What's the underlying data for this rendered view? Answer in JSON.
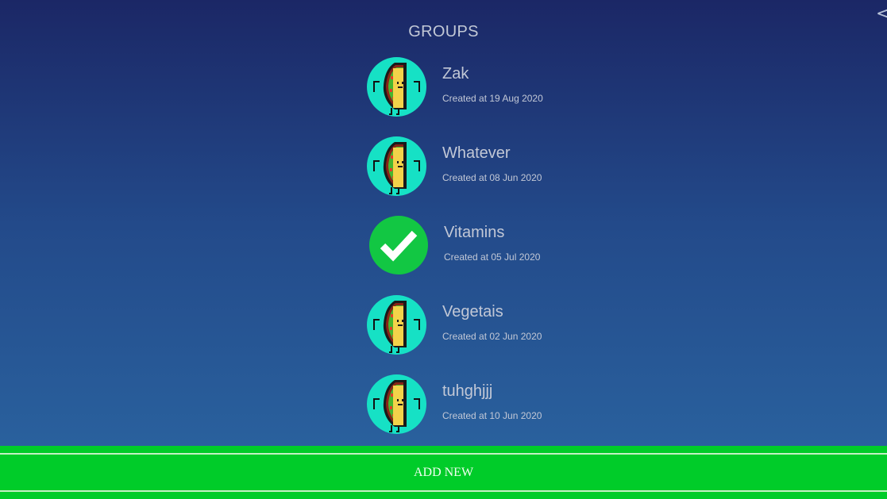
{
  "header": {
    "title": "GROUPS",
    "back_icon": "chevron-left-icon"
  },
  "groups": [
    {
      "name": "Zak",
      "created": "Created at 19 Aug 2020",
      "avatar": "taco-icon",
      "selected": false
    },
    {
      "name": "Whatever",
      "created": "Created at 08 Jun 2020",
      "avatar": "taco-icon",
      "selected": false
    },
    {
      "name": "Vitamins",
      "created": "Created at 05 Jul 2020",
      "avatar": "checkmark-icon",
      "selected": true
    },
    {
      "name": "Vegetais",
      "created": "Created at 02 Jun 2020",
      "avatar": "taco-icon",
      "selected": false
    },
    {
      "name": "tuhghjjj",
      "created": "Created at 10 Jun 2020",
      "avatar": "taco-icon",
      "selected": false
    }
  ],
  "footer": {
    "add_label": "ADD NEW"
  },
  "colors": {
    "background_top": "#1b2766",
    "background_bottom": "#2b66a2",
    "avatar_teal": "#16e1c5",
    "selected_green": "#12c743",
    "add_bar_green": "#00cc29",
    "text_light": "#c2c8d6"
  }
}
